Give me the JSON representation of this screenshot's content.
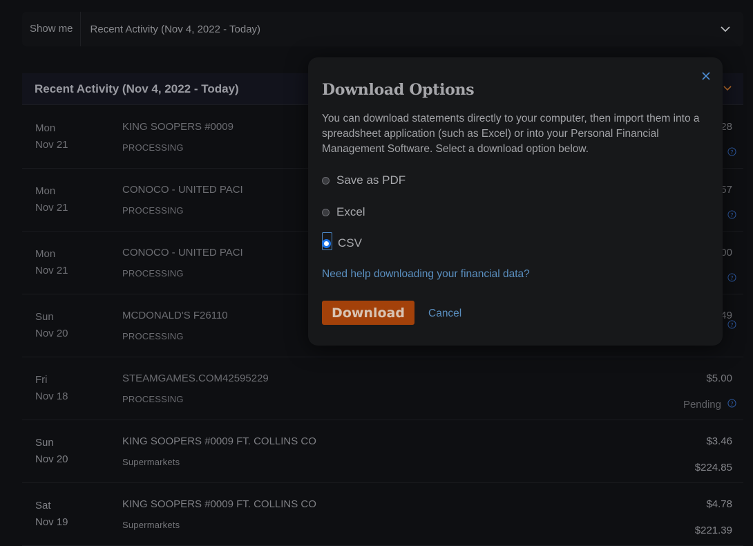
{
  "filter": {
    "label": "Show me",
    "value": "Recent Activity (Nov 4, 2022 - Today)"
  },
  "panel": {
    "title": "Recent Activity (Nov 4, 2022 - Today)"
  },
  "transactions": [
    {
      "dow": "Mon",
      "date": "Nov 21",
      "merchant": "KING SOOPERS #0009",
      "category": "PROCESSING",
      "amount": ".28",
      "status": ""
    },
    {
      "dow": "Mon",
      "date": "Nov 21",
      "merchant": "CONOCO - UNITED PACI",
      "category": "PROCESSING",
      "amount": ".57",
      "status": ""
    },
    {
      "dow": "Mon",
      "date": "Nov 21",
      "merchant": "CONOCO - UNITED PACI",
      "category": "PROCESSING",
      "amount": ".00",
      "status": ""
    },
    {
      "dow": "Sun",
      "date": "Nov 20",
      "merchant": "MCDONALD'S F26110",
      "category": "PROCESSING",
      "amount": ".49",
      "status": ""
    },
    {
      "dow": "Fri",
      "date": "Nov 18",
      "merchant": "STEAMGAMES.COM42595229",
      "category": "PROCESSING",
      "amount": "$5.00",
      "status": "Pending"
    },
    {
      "dow": "Sun",
      "date": "Nov 20",
      "merchant": "KING SOOPERS #0009 FT. COLLINS CO",
      "category": "Supermarkets",
      "amount": "$3.46",
      "status": "$224.85"
    },
    {
      "dow": "Sat",
      "date": "Nov 19",
      "merchant": "KING SOOPERS #0009 FT. COLLINS CO",
      "category": "Supermarkets",
      "amount": "$4.78",
      "status": "$221.39"
    }
  ],
  "modal": {
    "title": "Download Options",
    "description": "You can download statements directly to your computer, then import them into a spreadsheet application (such as Excel) or into your Personal Financial Management Software. Select a download option below.",
    "options": [
      {
        "label": "Save as PDF",
        "selected": false
      },
      {
        "label": "Excel",
        "selected": false
      },
      {
        "label": "CSV",
        "selected": true
      }
    ],
    "help_link": "Need help downloading your financial data?",
    "download_label": "Download",
    "cancel_label": "Cancel"
  },
  "colors": {
    "accent_button": "#a3410a",
    "link": "#5a8fc0",
    "radio_selected": "#1a73e8",
    "panel_chevron": "#c0702a"
  },
  "icons": {
    "filter_chevron": "chevron-down-icon",
    "panel_chevron": "chevron-down-icon",
    "close": "close-icon",
    "help": "question-circle-icon"
  }
}
